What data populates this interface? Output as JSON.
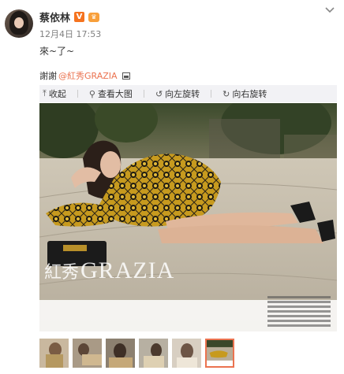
{
  "post": {
    "username": "蔡依林",
    "vip_badge": "V",
    "member_badge": "♛",
    "timestamp": "12月4日 17:53",
    "text": "來~了~",
    "thanks_prefix": "謝謝",
    "mention": "@紅秀GRAZIA"
  },
  "toolbar": {
    "collapse": "收起",
    "view_large": "查看大图",
    "rotate_left": "向左旋转",
    "rotate_right": "向右旋转"
  },
  "photo": {
    "watermark_cn": "紅秀",
    "watermark_en": "GRAZIA"
  },
  "colors": {
    "mention": "#eb7350",
    "toolbar_bg": "#f2f2f5",
    "vip_badge": "#f5731f"
  }
}
